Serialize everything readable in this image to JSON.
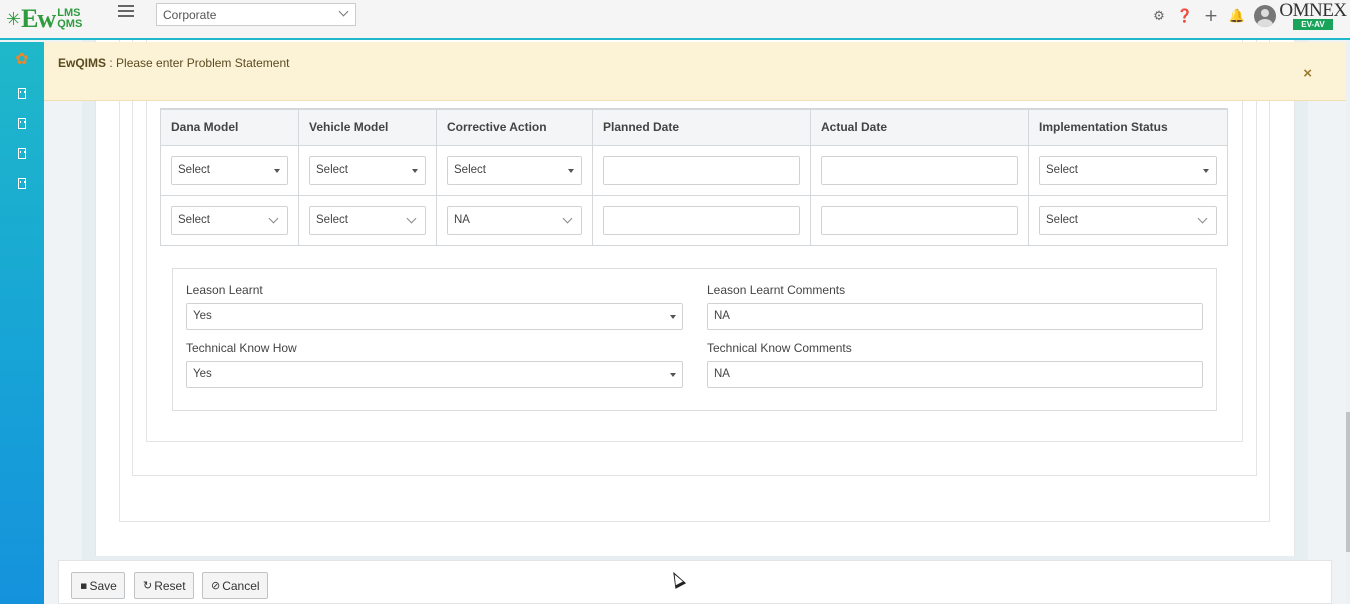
{
  "header": {
    "logo_prefix": "Ew",
    "logo_top": "LMS",
    "logo_bottom": "QMS",
    "org_value": "Corporate",
    "icons": [
      "gear-icon",
      "help-icon",
      "plus-icon",
      "bell-icon",
      "avatar"
    ],
    "brand_name": "OMNEX",
    "brand_tag": "EV-AV"
  },
  "sidebar": {
    "items": [
      "building-icon",
      "building-icon",
      "building-icon",
      "building-icon"
    ]
  },
  "alert": {
    "app": "EwQIMS",
    "separator": " : ",
    "message": "Please enter Problem Statement",
    "close": "×"
  },
  "grid": {
    "headers": [
      "Dana Model",
      "Vehicle Model",
      "Corrective Action",
      "Planned Date",
      "Actual Date",
      "Implementation Status"
    ],
    "rows": [
      {
        "dana": "Select",
        "vehicle": "Select",
        "corrective": "Select",
        "planned": "",
        "actual": "",
        "status": "Select"
      },
      {
        "dana": "Select",
        "vehicle": "Select",
        "corrective": "NA",
        "planned": "",
        "actual": "",
        "status": "Select"
      }
    ]
  },
  "lesson": {
    "lesson_learnt_label": "Leason Learnt",
    "lesson_learnt_value": "Yes",
    "lesson_comments_label": "Leason Learnt Comments",
    "lesson_comments_value": "NA",
    "tech_label": "Technical Know How",
    "tech_value": "Yes",
    "tech_comments_label": "Technical Know Comments",
    "tech_comments_value": "NA"
  },
  "footer": {
    "save": "Save",
    "reset": "Reset",
    "cancel": "Cancel"
  }
}
